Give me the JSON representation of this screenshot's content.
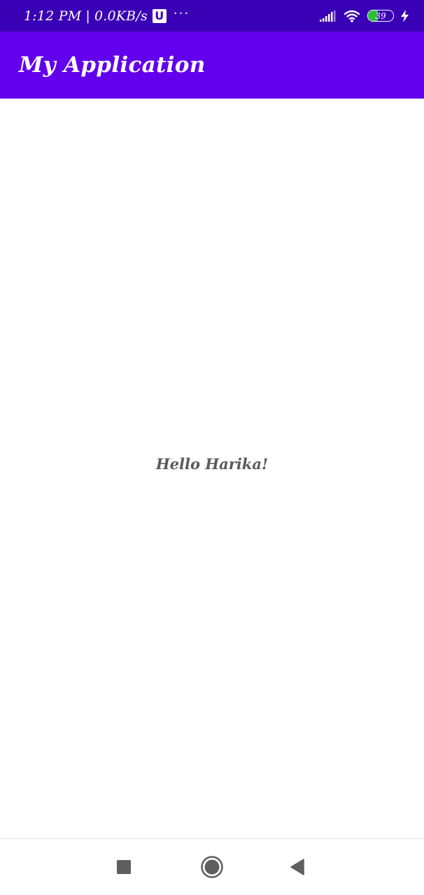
{
  "status_bar": {
    "time": "1:12 PM",
    "separator": "|",
    "network_speed": "0.0KB/s",
    "notification_badge": "U",
    "more_indicator": "···",
    "battery_level": "39",
    "battery_fraction": 0.39,
    "icons": [
      "signal-icon",
      "wifi-icon",
      "battery-icon",
      "charging-bolt-icon"
    ]
  },
  "app_bar": {
    "title": "My Application"
  },
  "main": {
    "greeting": "Hello Harika!"
  },
  "nav_bar": {
    "icons": [
      "recents-square-icon",
      "home-circle-icon",
      "back-triangle-icon"
    ]
  },
  "colors": {
    "status_bar": "#3A00B6",
    "app_bar": "#6200EE",
    "greeting_text": "#5b5b5b",
    "battery_fill": "#2fbf3a"
  }
}
